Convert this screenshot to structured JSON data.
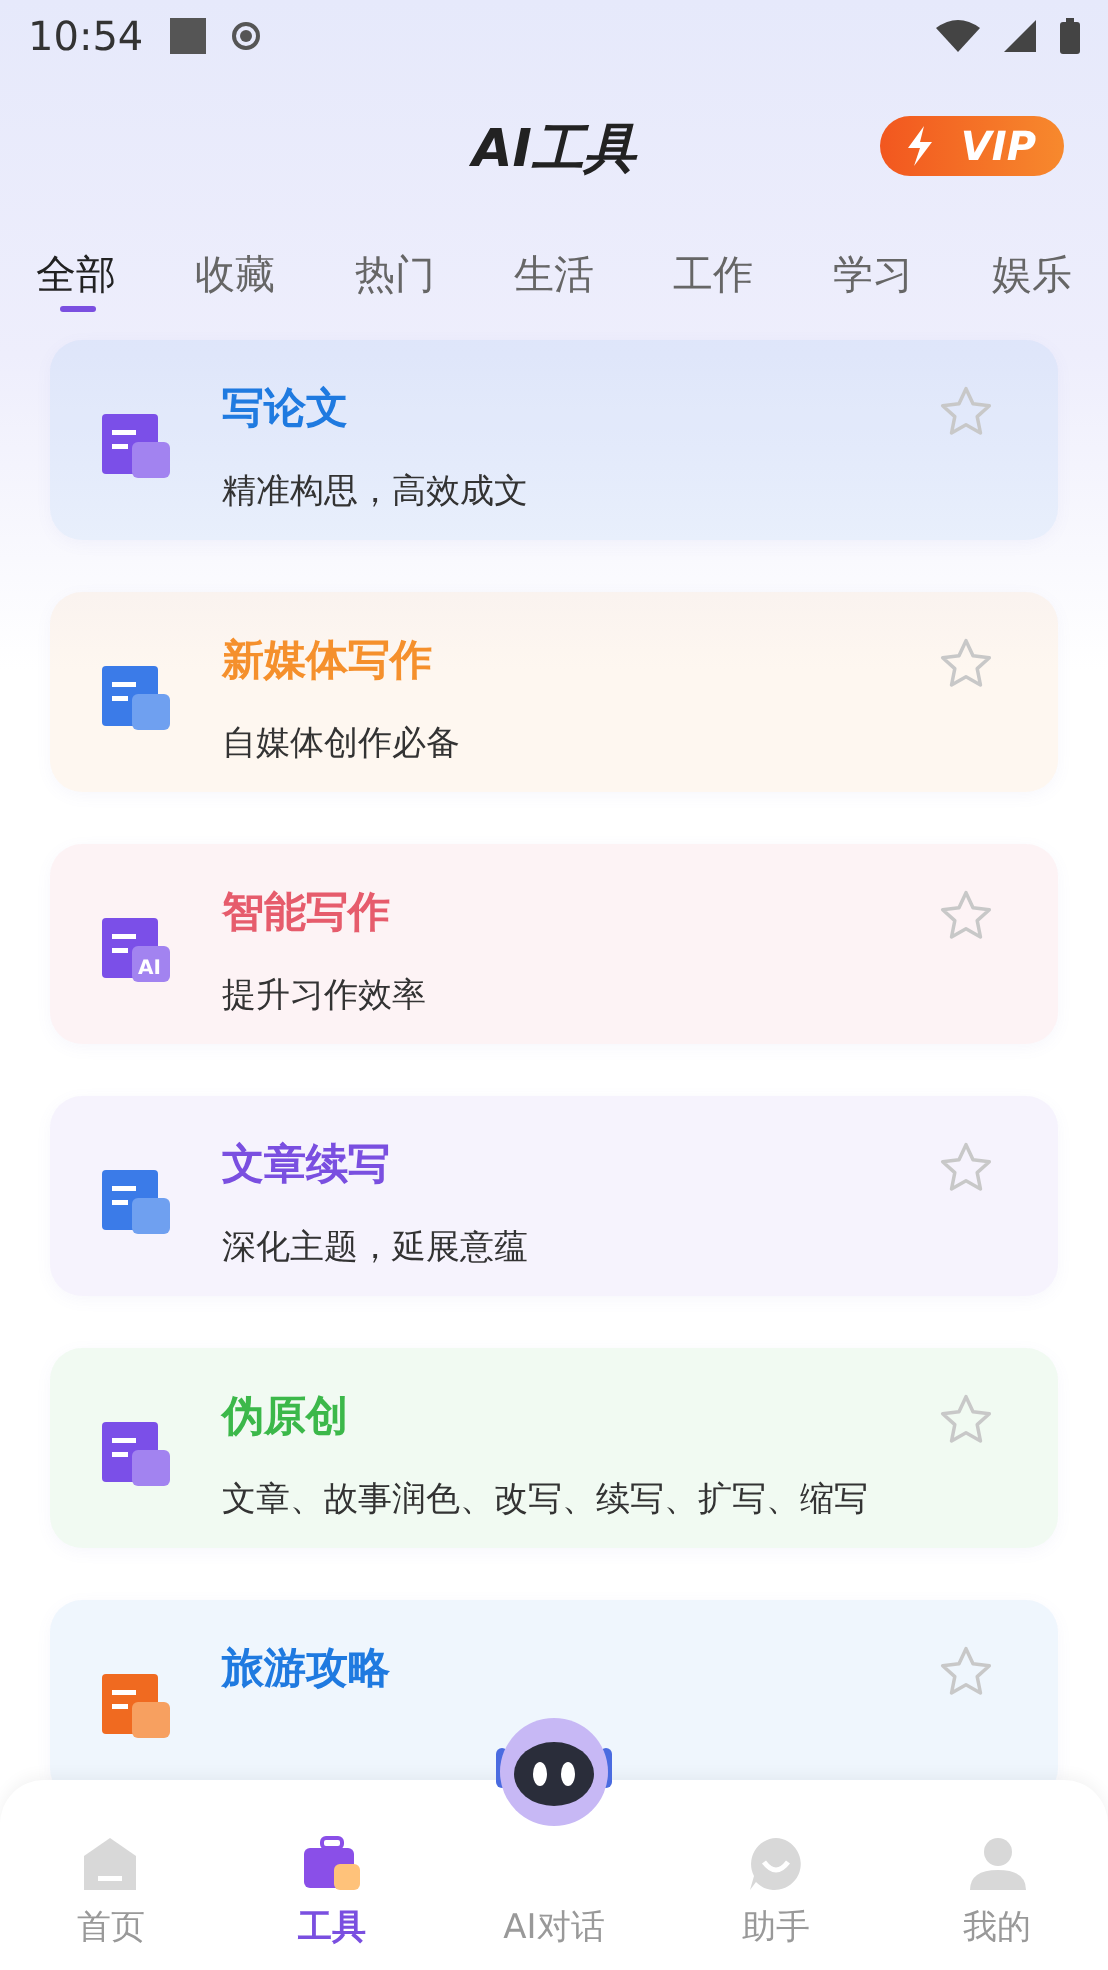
{
  "status_bar": {
    "time": "10:54"
  },
  "header": {
    "title": "AI工具",
    "vip_badge": "VIP"
  },
  "tabs": [
    {
      "label": "全部",
      "selected": true
    },
    {
      "label": "收藏",
      "selected": false
    },
    {
      "label": "热门",
      "selected": false
    },
    {
      "label": "生活",
      "selected": false
    },
    {
      "label": "工作",
      "selected": false
    },
    {
      "label": "学习",
      "selected": false
    },
    {
      "label": "娱乐",
      "selected": false
    }
  ],
  "tools": [
    {
      "kind": "thesis",
      "title": "写论文",
      "subtitle": "精准构思，高效成文",
      "color": "#1f7ae0",
      "starred": false
    },
    {
      "kind": "media",
      "title": "新媒体写作",
      "subtitle": "自媒体创作必备",
      "color": "#f5902c",
      "starred": false
    },
    {
      "kind": "ai",
      "icon_badge": "AI",
      "title": "智能写作",
      "subtitle": "提升习作效率",
      "color": "#e65c6c",
      "starred": false
    },
    {
      "kind": "continue",
      "title": "文章续写",
      "subtitle": "深化主题，延展意蕴",
      "color": "#7a4fe0",
      "starred": false
    },
    {
      "kind": "rewrite",
      "title": "伪原创",
      "subtitle": "文章、故事润色、改写、续写、扩写、缩写",
      "color": "#3cb84a",
      "starred": false
    },
    {
      "kind": "travel",
      "title": "旅游攻略",
      "color": "#1f7ae0",
      "starred": false
    }
  ],
  "bottom_nav": [
    {
      "kind": "home",
      "label": "首页",
      "selected": false
    },
    {
      "kind": "tools",
      "label": "工具",
      "selected": true
    },
    {
      "kind": "robot",
      "label": "AI对话",
      "selected": false
    },
    {
      "kind": "assistant",
      "label": "助手",
      "selected": false
    },
    {
      "kind": "profile",
      "label": "我的",
      "selected": false
    }
  ]
}
